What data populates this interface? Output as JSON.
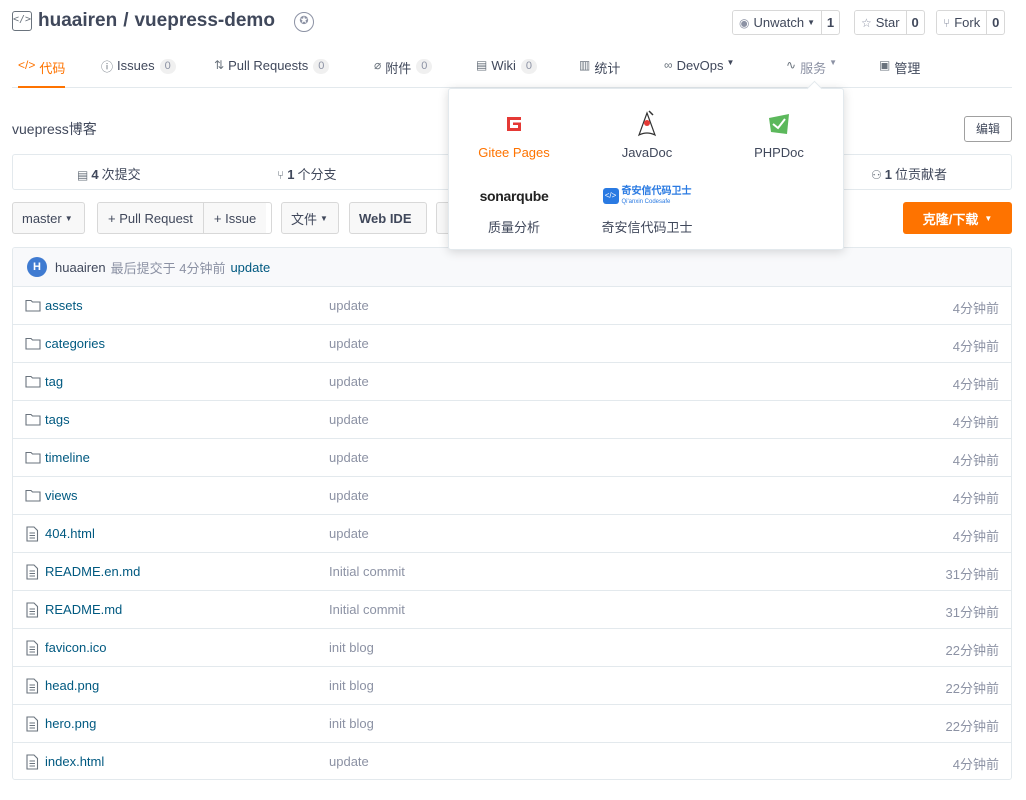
{
  "repo": {
    "owner": "huaairen",
    "separator": "/",
    "name": "vuepress-demo"
  },
  "actions": {
    "watch_label": "Unwatch",
    "watch_count": "1",
    "star_label": "Star",
    "star_count": "0",
    "fork_label": "Fork",
    "fork_count": "0"
  },
  "tabs": [
    {
      "label": "代码",
      "active": true
    },
    {
      "label": "Issues",
      "count": "0"
    },
    {
      "label": "Pull Requests",
      "count": "0"
    },
    {
      "label": "附件",
      "count": "0"
    },
    {
      "label": "Wiki",
      "count": "0"
    },
    {
      "label": "统计"
    },
    {
      "label": "DevOps"
    },
    {
      "label": "服务"
    },
    {
      "label": "管理"
    }
  ],
  "description": "vuepress博客",
  "edit_label": "编辑",
  "stats": {
    "commits_count": "4",
    "commits_label": "次提交",
    "branches_count": "1",
    "branches_label": "个分支",
    "contributors_count": "1",
    "contributors_label": "位贡献者"
  },
  "toolbar": {
    "branch": "master",
    "pull_request": "+ Pull Request",
    "issue": "+ Issue",
    "files": "文件",
    "web_ide": "Web IDE",
    "clone": "克隆/下载"
  },
  "last_commit": {
    "avatar_letter": "H",
    "author": "huaairen",
    "meta": "最后提交于 4分钟前",
    "message": "update"
  },
  "files": [
    {
      "type": "folder",
      "name": "assets",
      "message": "update",
      "time": "4分钟前"
    },
    {
      "type": "folder",
      "name": "categories",
      "message": "update",
      "time": "4分钟前"
    },
    {
      "type": "folder",
      "name": "tag",
      "message": "update",
      "time": "4分钟前"
    },
    {
      "type": "folder",
      "name": "tags",
      "message": "update",
      "time": "4分钟前"
    },
    {
      "type": "folder",
      "name": "timeline",
      "message": "update",
      "time": "4分钟前"
    },
    {
      "type": "folder",
      "name": "views",
      "message": "update",
      "time": "4分钟前"
    },
    {
      "type": "file",
      "name": "404.html",
      "message": "update",
      "time": "4分钟前"
    },
    {
      "type": "file",
      "name": "README.en.md",
      "message": "Initial commit",
      "time": "31分钟前"
    },
    {
      "type": "file",
      "name": "README.md",
      "message": "Initial commit",
      "time": "31分钟前"
    },
    {
      "type": "file",
      "name": "favicon.ico",
      "message": "init blog",
      "time": "22分钟前"
    },
    {
      "type": "file",
      "name": "head.png",
      "message": "init blog",
      "time": "22分钟前"
    },
    {
      "type": "file",
      "name": "hero.png",
      "message": "init blog",
      "time": "22分钟前"
    },
    {
      "type": "file",
      "name": "index.html",
      "message": "update",
      "time": "4分钟前"
    }
  ],
  "services": {
    "gitee_pages": "Gitee Pages",
    "javadoc": "JavaDoc",
    "phpdoc": "PHPDoc",
    "sonarqube_logo": "sonarqube",
    "sonarqube": "质量分析",
    "qianxin_logo": "奇安信代码卫士",
    "qianxin_sub": "Qi'anxin Codesafe",
    "qianxin": "奇安信代码卫士"
  },
  "colors": {
    "accent": "#fe7300",
    "link": "#005980",
    "muted": "#8c92a4",
    "text": "#40485b"
  }
}
